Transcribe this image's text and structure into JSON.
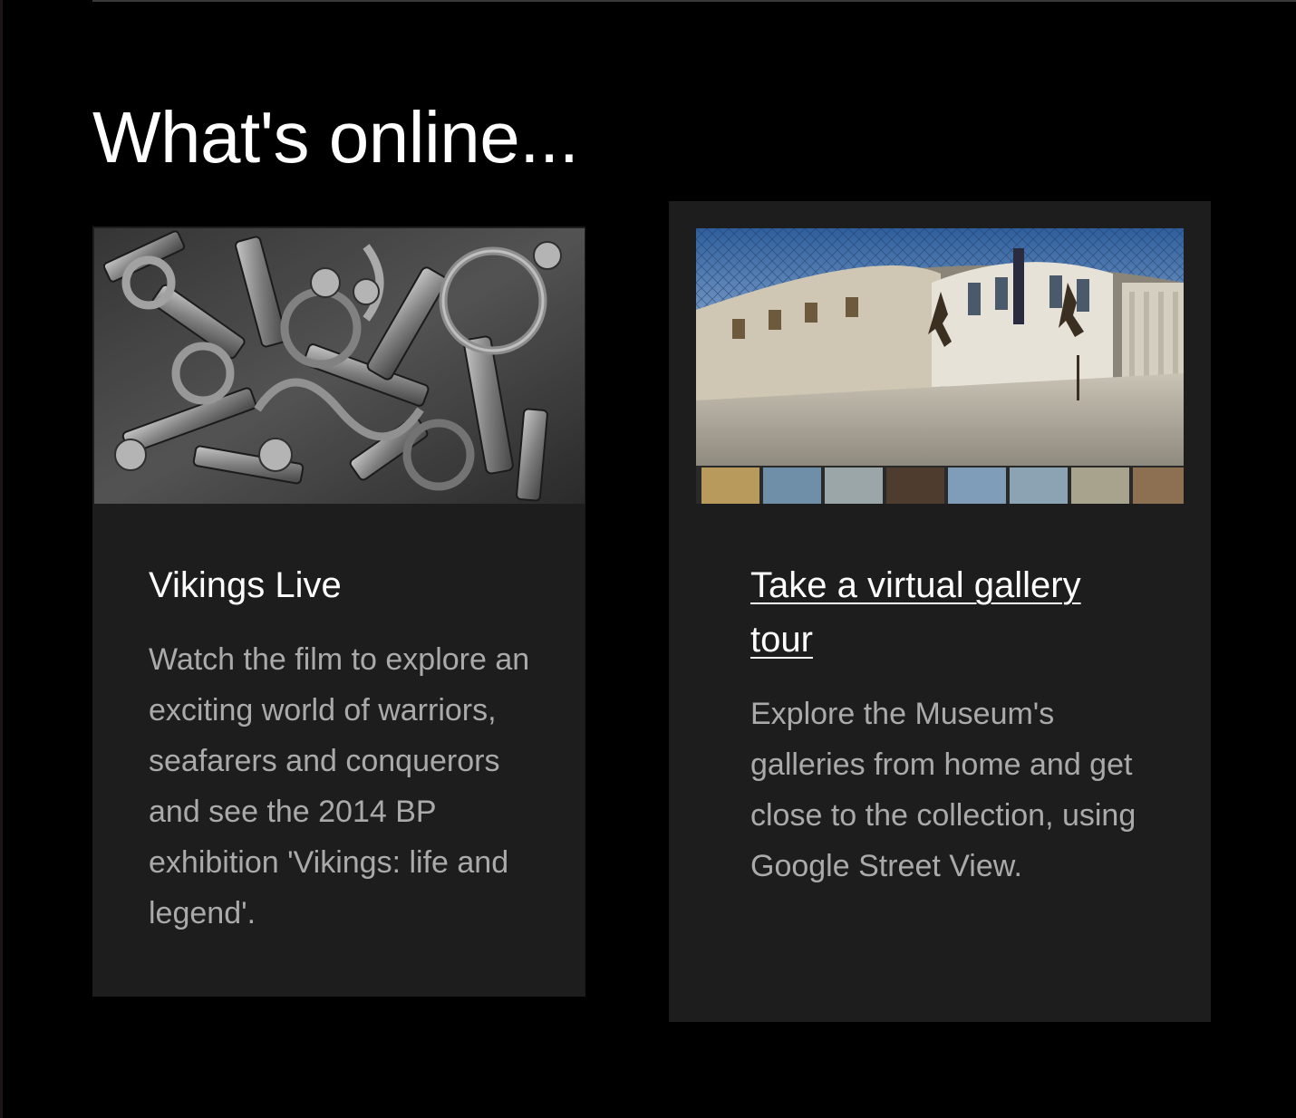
{
  "section": {
    "title": "What's online..."
  },
  "cards": [
    {
      "title": "Vikings Live",
      "description": "Watch the film to explore an exciting world of warriors, seafarers and conquerors and see the 2014 BP exhibition 'Vikings: life and legend'.",
      "image_alt": "Viking silver hoard"
    },
    {
      "title": "Take a virtual gallery tour",
      "description": "Explore the Museum's galleries from home and get close to the collection, using Google Street View.",
      "image_alt": "Google Street View of the Museum's Great Court"
    }
  ],
  "colors": {
    "background": "#000000",
    "card_background": "#1d1d1d",
    "title": "#ffffff",
    "description": "#aaaaaa"
  }
}
